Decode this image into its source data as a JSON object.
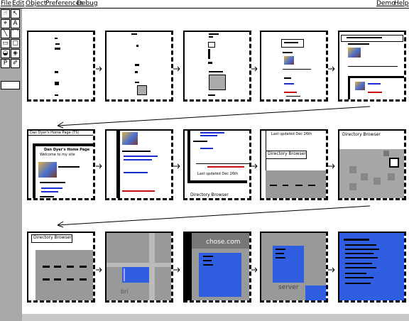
{
  "menu": {
    "file": "File",
    "edit": "Edit",
    "object": "Object",
    "preferences": "Preferences",
    "debug": "Debug",
    "demo": "Demo",
    "help": "Help"
  },
  "palette": {
    "tools": [
      "pointer-icon",
      "hand-icon",
      "select-icon",
      "text-icon",
      "line-icon",
      "curve-icon",
      "rectangle-icon",
      "rounded-rectangle-icon",
      "oval-icon",
      "polygon-icon",
      "paint-icon",
      "eyedropper-icon"
    ]
  },
  "panels": {
    "p2_1": {
      "title": "Dan Dyer's Home Page",
      "text": "Welcome to my site"
    },
    "p2_3": {
      "text": "Directory Browser",
      "footer": "Last updated Dec 26th"
    },
    "p2_4": {
      "title": "Directory Browser"
    },
    "p2_5": {
      "title": "Directory Browser"
    },
    "p3_1": {
      "title": "Directory Browser"
    },
    "p3_3": {
      "title": "chose.com"
    },
    "p3_4": {
      "text": "server"
    }
  },
  "colors": {
    "accent_blue": "#2f5fe0",
    "canvas": "#ffffff",
    "chrome": "#a8a8a8"
  }
}
